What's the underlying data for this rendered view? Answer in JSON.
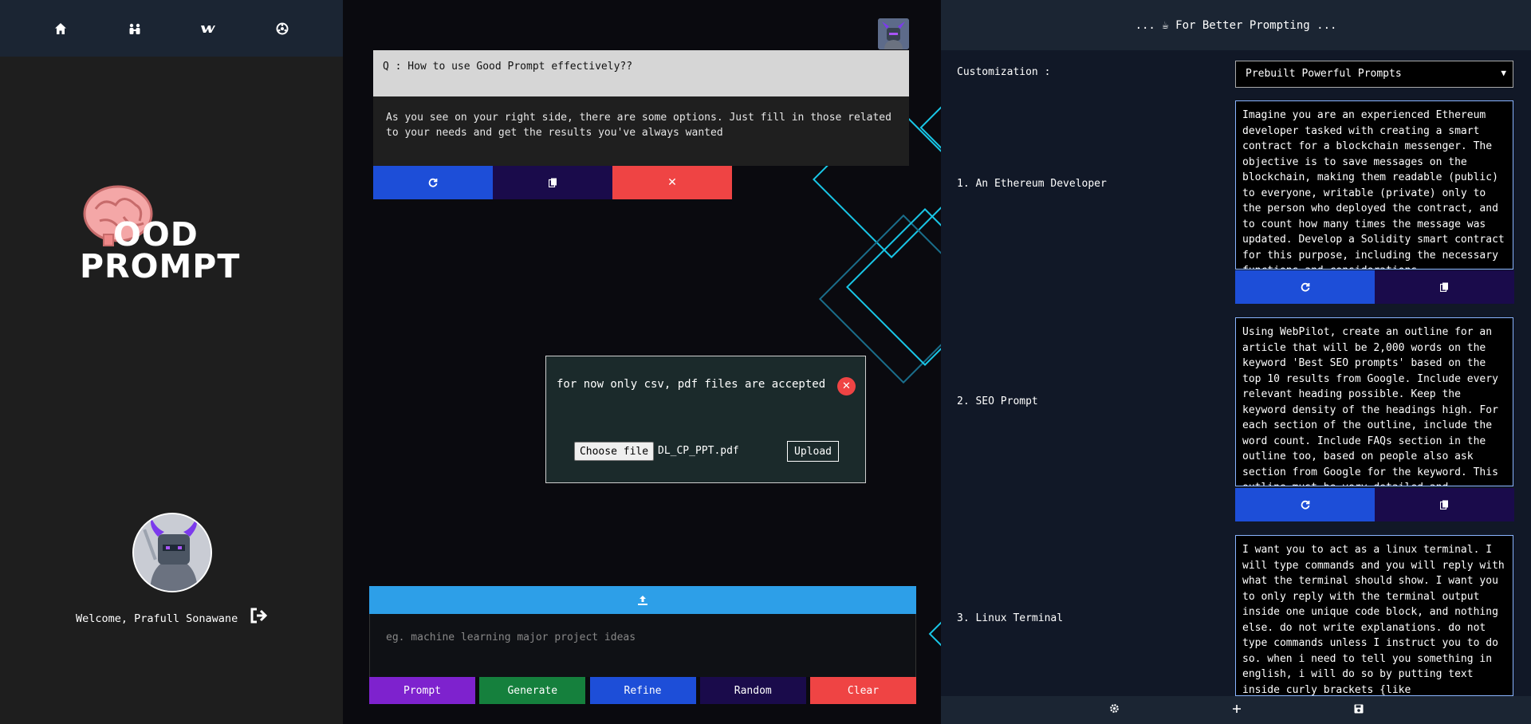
{
  "nav": {
    "items": [
      {
        "name": "home",
        "icon": "home-icon"
      },
      {
        "name": "community",
        "icon": "users-icon"
      },
      {
        "name": "webflow",
        "icon": "w-icon"
      },
      {
        "name": "settings",
        "icon": "circle-icon"
      }
    ]
  },
  "sidebar": {
    "logo_text_line1": "OOD",
    "logo_text_line2": "PROMPT",
    "welcome": "Welcome, Prafull Sonawane"
  },
  "qa": {
    "question": "Q : How to use Good Prompt effectively??",
    "answer": "As you see on your right side, there are some options. Just fill in those related to your needs and get the results you've always wanted"
  },
  "upload_modal": {
    "message": "for now only csv, pdf files are accepted",
    "choose_file_label": "Choose file",
    "file_name": "DL_CP_PPT.pdf",
    "upload_label": "Upload"
  },
  "composer": {
    "placeholder": "eg. machine learning major project ideas",
    "buttons": {
      "prompt": "Prompt",
      "generate": "Generate",
      "refine": "Refine",
      "random": "Random",
      "clear": "Clear"
    }
  },
  "right_panel": {
    "header": "... ☕ For Better Prompting ...",
    "customization_label": "Customization :",
    "select_value": "Prebuilt Powerful Prompts",
    "prompts": [
      {
        "label": "1. An Ethereum Developer",
        "text": "Imagine you are an experienced Ethereum developer tasked with creating a smart contract for a blockchain messenger. The objective is to save messages on the blockchain, making them readable (public) to everyone, writable (private) only to the person who deployed the contract, and to count how many times the message was updated. Develop a Solidity smart contract for this purpose, including the necessary functions and considerations"
      },
      {
        "label": "2. SEO Prompt",
        "text": "Using WebPilot, create an outline for an article that will be 2,000 words on the keyword 'Best SEO prompts' based on the top 10 results from Google. Include every relevant heading possible. Keep the keyword density of the headings high. For each section of the outline, include the word count. Include FAQs section in the outline too, based on people also ask section from Google for the keyword. This outline must be very detailed and"
      },
      {
        "label": "3. Linux Terminal",
        "text": "I want you to act as a linux terminal. I will type commands and you will reply with what the terminal should show. I want you to only reply with the terminal output inside one unique code block, and nothing else. do not write explanations. do not type commands unless I instruct you to do so. when i need to tell you something in english, i will do so by putting text inside curly brackets {like"
      }
    ]
  },
  "colors": {
    "blue": "#1d4ed8",
    "navy": "#1a0b4b",
    "red": "#ef4444",
    "purple": "#7e22ce",
    "green": "#15803d",
    "sky": "#2d9fe8",
    "cyan_deco": "#19c6e6"
  }
}
